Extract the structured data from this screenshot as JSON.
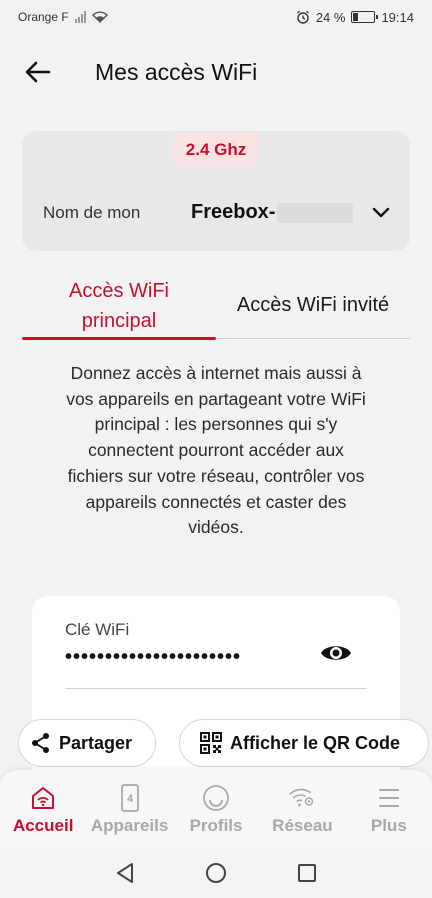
{
  "status": {
    "carrier": "Orange F",
    "battery": "24 %",
    "battery_level": 0.24,
    "time": "19:14"
  },
  "header": {
    "title": "Mes accès WiFi",
    "back_icon": "arrow-left-icon"
  },
  "network": {
    "frequency": "2.4 Ghz",
    "label": "Nom de mon",
    "name": "Freebox-",
    "dropdown_icon": "chevron-down-icon"
  },
  "tabs": [
    {
      "label": "Accès WiFi principal",
      "active": true
    },
    {
      "label": "Accès WiFi invité",
      "active": false
    }
  ],
  "description": "Donnez accès à internet mais aussi à vos appareils en partageant votre WiFi principal : les personnes qui s'y connectent pourront accéder aux fichiers sur votre réseau, contrôler vos appareils connectés et caster des vidéos.",
  "wifi_key": {
    "label": "Clé WiFi",
    "value": "••••••••••••••••••••••",
    "toggle_icon": "eye-icon"
  },
  "actions": {
    "share": "Partager",
    "qr": "Afficher le QR Code"
  },
  "bottom_nav": [
    {
      "label": "Accueil",
      "icon": "home-wifi-icon",
      "active": true
    },
    {
      "label": "Appareils",
      "icon": "device-icon",
      "badge": "4",
      "active": false
    },
    {
      "label": "Profils",
      "icon": "profile-icon",
      "active": false
    },
    {
      "label": "Réseau",
      "icon": "network-settings-icon",
      "active": false
    },
    {
      "label": "Plus",
      "icon": "menu-icon",
      "active": false
    }
  ],
  "colors": {
    "accent": "#c8102e",
    "background": "#f2f2f2",
    "inactive": "#a8a8a8"
  }
}
